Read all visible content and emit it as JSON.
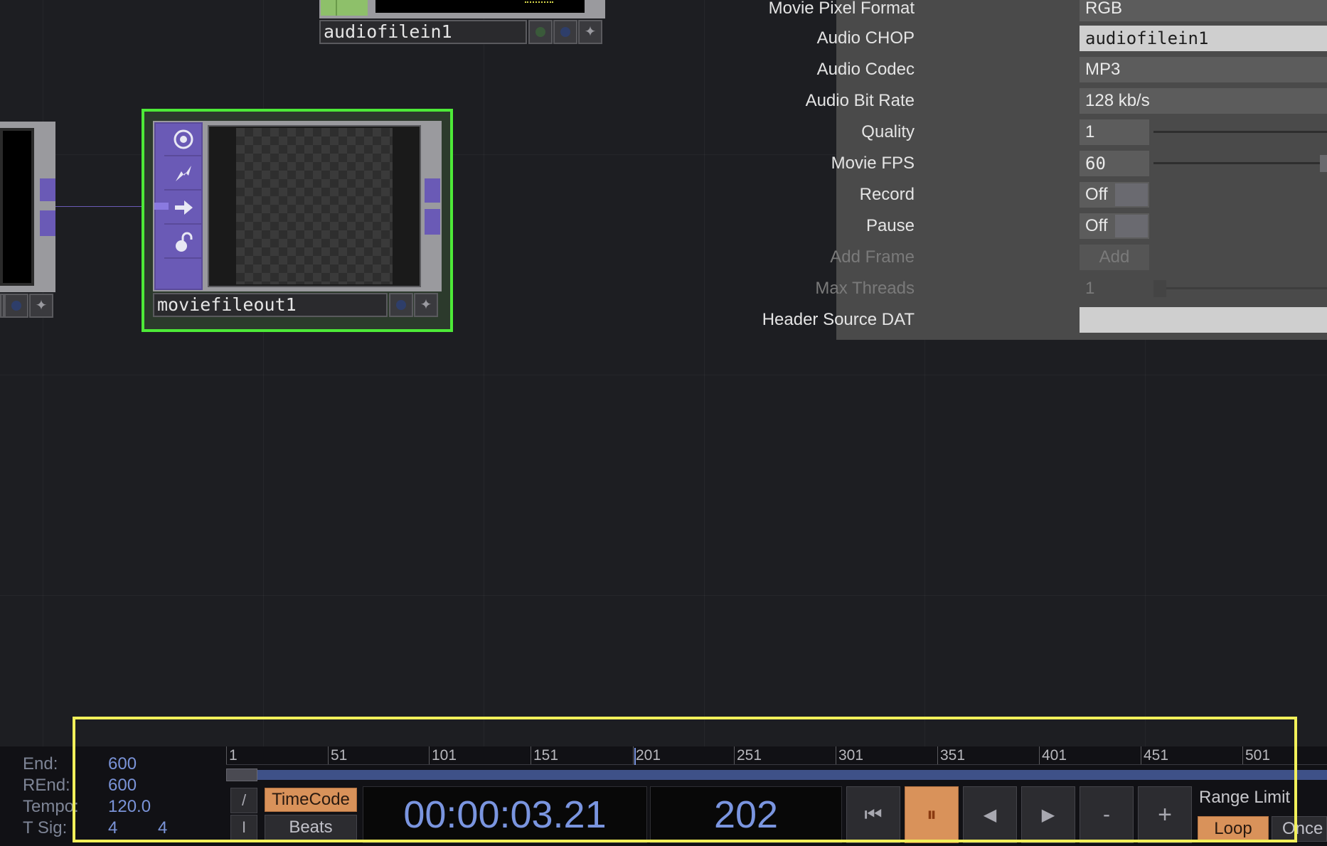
{
  "colors": {
    "background": "#1d1e22",
    "node_purple": "#6a5ab6",
    "selection_green": "#4dea38",
    "highlight_yellow": "#f2f05a",
    "param_panel": "#4a4a4a",
    "active_orange": "#d9925a",
    "time_blue": "#7a95e0"
  },
  "nodes": {
    "audiofilein": {
      "name": "audiofilein1"
    },
    "moviefileout": {
      "name": "moviefileout1",
      "icons": [
        "target-icon",
        "lightning-icon",
        "arrow-right-icon",
        "lock-open-icon"
      ]
    }
  },
  "parameters": {
    "movie_pixel_format": {
      "label": "Movie Pixel Format",
      "value": "RGB"
    },
    "audio_chop": {
      "label": "Audio CHOP",
      "value": "audiofilein1"
    },
    "audio_codec": {
      "label": "Audio Codec",
      "value": "MP3"
    },
    "audio_bit_rate": {
      "label": "Audio Bit Rate",
      "value": "128 kb/s"
    },
    "quality": {
      "label": "Quality",
      "value": "1"
    },
    "movie_fps": {
      "label": "Movie FPS",
      "value": "60"
    },
    "record": {
      "label": "Record",
      "value": "Off"
    },
    "pause": {
      "label": "Pause",
      "value": "Off"
    },
    "add_frame": {
      "label": "Add Frame",
      "button": "Add"
    },
    "max_threads": {
      "label": "Max Threads",
      "value": "1"
    },
    "header_source_dat": {
      "label": "Header Source DAT",
      "value": ""
    }
  },
  "timeline": {
    "info": {
      "end_label": "End:",
      "end_value": "600",
      "rend_label": "REnd:",
      "rend_value": "600",
      "tempo_label": "Tempo:",
      "tempo_value": "120.0",
      "tsig_label": "T Sig:",
      "tsig_num": "4",
      "tsig_den": "4"
    },
    "ruler_ticks": [
      "1",
      "51",
      "101",
      "151",
      "201",
      "251",
      "301",
      "351",
      "401",
      "451",
      "501"
    ],
    "current_frame_marker": 201,
    "mode_buttons": {
      "timecode": "TimeCode",
      "beats": "Beats"
    },
    "side_glyphs": {
      "top": "/",
      "bottom": "I"
    },
    "timecode": "00:00:03.21",
    "frame": "202",
    "transport": {
      "rewind": "⏮",
      "pause": "⏸",
      "step_back": "◀",
      "step_forward": "▶",
      "minus": "-",
      "plus": "+"
    },
    "range_limit_label": "Range Limit",
    "loop_label": "Loop",
    "once_label": "Once"
  }
}
